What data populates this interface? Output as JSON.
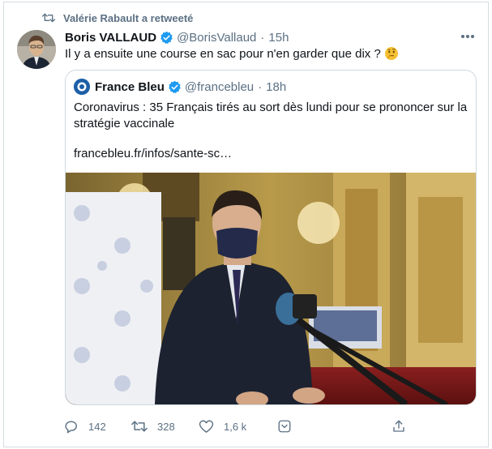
{
  "retweet": {
    "text": "Valérie Rabault a retweeté",
    "icon": "retweet-icon"
  },
  "tweet": {
    "author_name": "Boris VALLAUD",
    "handle": "@BorisVallaud",
    "separator": "·",
    "time": "15h",
    "text": "Il y a ensuite une course en sac pour n'en garder que dix ?",
    "emoji": "thinking-face-icon"
  },
  "quote": {
    "author_name": "France Bleu",
    "handle": "@francebleu",
    "separator": "·",
    "time": "18h",
    "text": "Coronavirus : 35 Français tirés au sort dès lundi pour se prononcer sur la stratégie vaccinale",
    "link": "francebleu.fr/infos/sante-sc…",
    "image_description_icon": "press-conference-photo"
  },
  "actions": {
    "reply_count": "142",
    "retweet_count": "328",
    "like_count": "1,6 k"
  },
  "colors": {
    "verified": "#1d9bf0",
    "muted": "#5b7083",
    "border": "#cfd9de"
  }
}
